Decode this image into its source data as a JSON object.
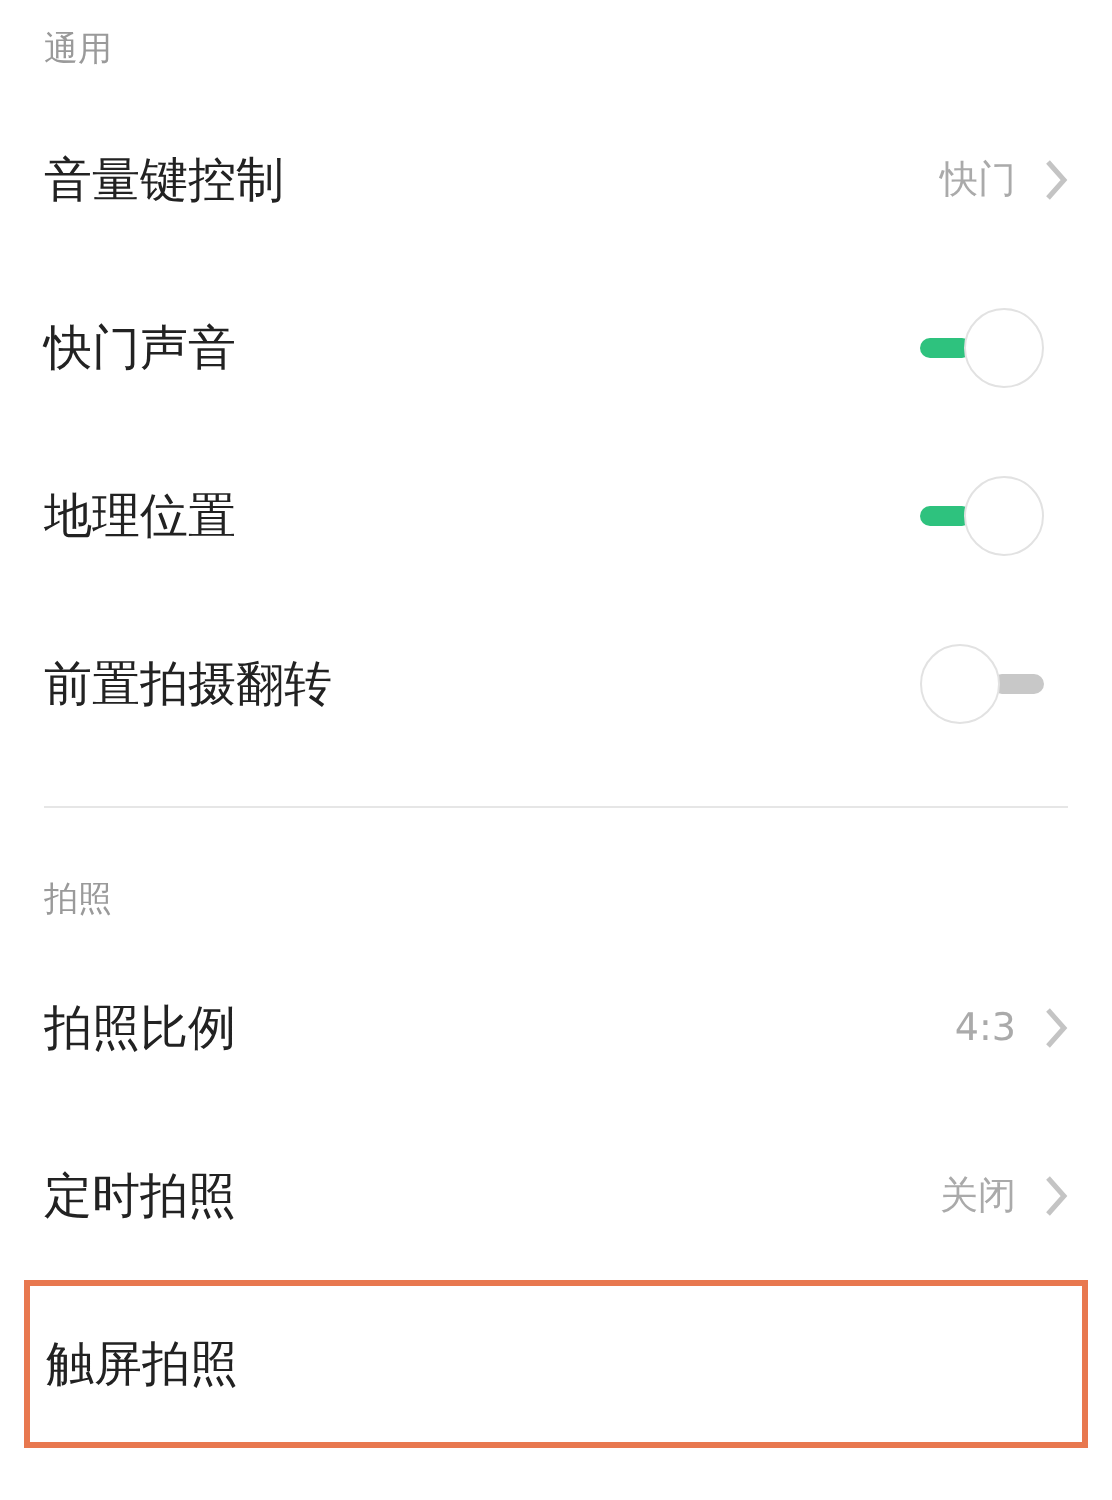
{
  "sections": [
    {
      "title": "通用",
      "rows": [
        {
          "kind": "link",
          "label": "音量键控制",
          "value": "快门",
          "highlighted": false
        },
        {
          "kind": "toggle",
          "label": "快门声音",
          "on": true,
          "highlighted": false
        },
        {
          "kind": "toggle",
          "label": "地理位置",
          "on": true,
          "highlighted": false
        },
        {
          "kind": "toggle",
          "label": "前置拍摄翻转",
          "on": false,
          "highlighted": false
        }
      ]
    },
    {
      "title": "拍照",
      "rows": [
        {
          "kind": "link",
          "label": "拍照比例",
          "value": "4:3",
          "highlighted": false
        },
        {
          "kind": "link",
          "label": "定时拍照",
          "value": "关闭",
          "highlighted": false
        },
        {
          "kind": "plain",
          "label": "触屏拍照",
          "highlighted": true
        }
      ]
    }
  ]
}
